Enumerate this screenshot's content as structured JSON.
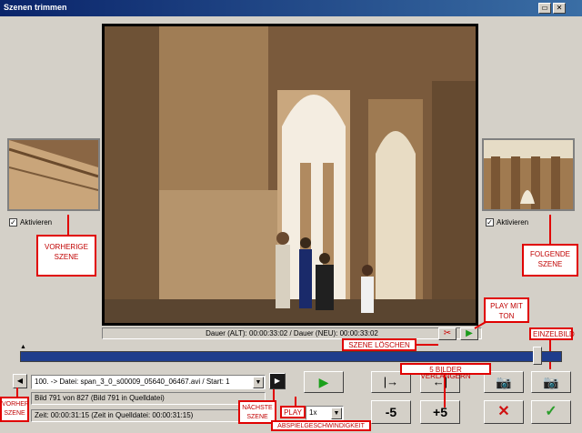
{
  "window": {
    "title": "Szenen trimmen"
  },
  "left_thumb": {
    "checkbox_label": "Aktivieren"
  },
  "right_thumb": {
    "checkbox_label": "Aktivieren"
  },
  "duration": {
    "text": "Dauer (ALT): 00:00:33:02  /  Dauer (NEU): 00:00:33:02"
  },
  "annotations": {
    "prev_scene": "VORHERIGE SZENE",
    "next_scene_right": "FOLGENDE SZENE",
    "play_with_sound": "PLAY MIT TON",
    "delete_scene": "SZENE LÖSCHEN",
    "single_frame": "EINZELBILD",
    "extend_5": "5 BILDER VERLÄNGERN",
    "prev_short": "VORHER SZENE",
    "next_short": "NÄCHSTE SZENE",
    "play": "PLAY",
    "speed": "ABSPIELGESCHWINDIGKEIT"
  },
  "scene_select": {
    "value": "100. -> Datei: span_3_0_s00009_05640_06467.avi / Start: 1"
  },
  "frame_info": "Bild 791 von 827 (Bild 791 in Quelldatei)",
  "time_info": "Zeit: 00:00:31:15 (Zeit in Quelldatei: 00:00:31:15)",
  "speed_select": {
    "value": "1x"
  },
  "buttons": {
    "minus5": "-5",
    "plus5": "+5"
  },
  "timeline": {
    "position": 0.95
  },
  "colors": {
    "annotation": "#e00000",
    "timeline": "#1f3d8c",
    "ok": "#2a9d2a",
    "cancel": "#d01010"
  }
}
